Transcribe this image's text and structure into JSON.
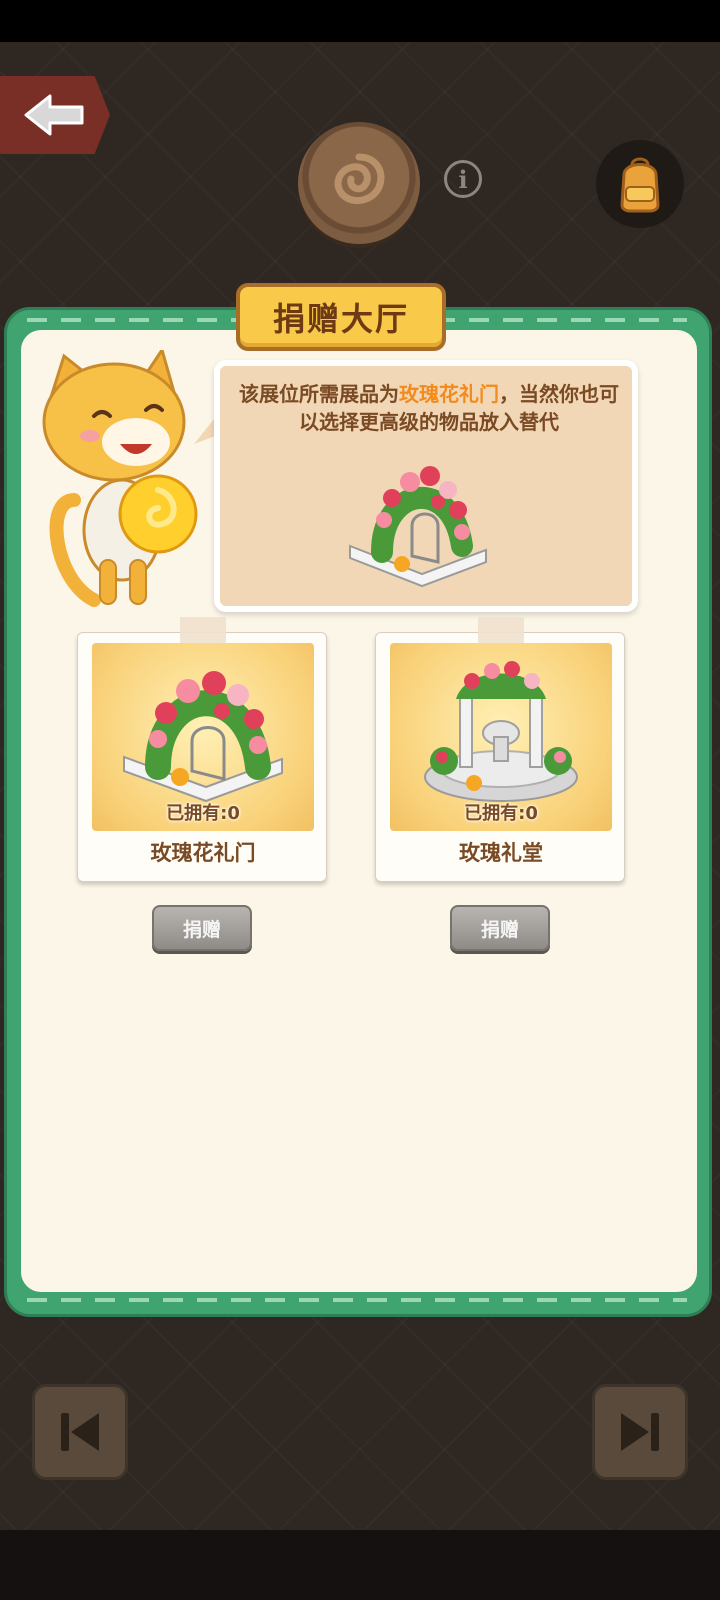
{
  "hud": {
    "back_icon": "back-arrow-icon",
    "emblem_icon": "rose-emblem-icon",
    "info_icon": "info-icon",
    "info_glyph": "i",
    "bag_icon": "backpack-icon"
  },
  "panel": {
    "title": "捐赠大厅",
    "speech_prefix": "该展位所需展品为",
    "speech_highlight": "玫瑰花礼门",
    "speech_suffix": "，当然你也可以选择更高级的物品放入替代"
  },
  "items": [
    {
      "name": "玫瑰花礼门",
      "owned": "已拥有:0",
      "button": "捐赠"
    },
    {
      "name": "玫瑰礼堂",
      "owned": "已拥有:0",
      "button": "捐赠"
    }
  ],
  "nav": {
    "prev_icon": "skip-previous-icon",
    "next_icon": "skip-next-icon"
  },
  "colors": {
    "panel_green": "#40a471",
    "panel_cream": "#fcf6e8",
    "title_yellow": "#f9c94a",
    "text_brown": "#7a4a25",
    "highlight_orange": "#f28a1c"
  }
}
